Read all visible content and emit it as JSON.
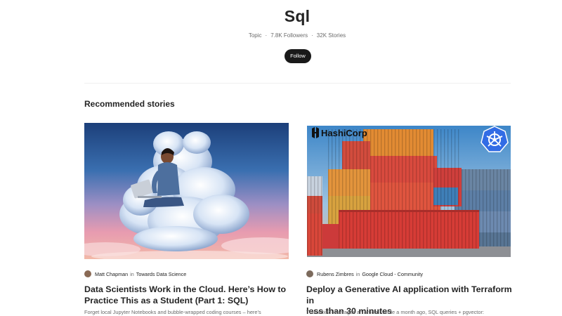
{
  "topic": {
    "title": "Sql",
    "type_label": "Topic",
    "followers": "7.8K Followers",
    "stories": "32K Stories",
    "follow_label": "Follow"
  },
  "section": {
    "heading": "Recommended stories"
  },
  "stories": [
    {
      "author": "Matt Chapman",
      "in_label": "in",
      "publication": "Towards Data Science",
      "title_line1": "Data Scientists Work in the Cloud. Here’s How to",
      "title_line2": "Practice This as a Student (Part 1: SQL)",
      "subtitle": "Forget local Jupyter Notebooks and bubble-wrapped coding courses – here’s"
    },
    {
      "author": "Rubens Zimbres",
      "in_label": "in",
      "publication": "Google Cloud - Community",
      "title_line1": "Deploy a Generative AI application with Terraform in",
      "title_line2": "less than 30 minutes",
      "subtitle": "This article leverages an article I wrote a month ago, SQL queries + pgvector:",
      "image_logo_text": "HashiCorp"
    }
  ],
  "colors": {
    "follow_bg": "#191919",
    "text_primary": "#242424",
    "text_secondary": "#6b6b6b",
    "kubernetes_blue": "#326ce5"
  }
}
